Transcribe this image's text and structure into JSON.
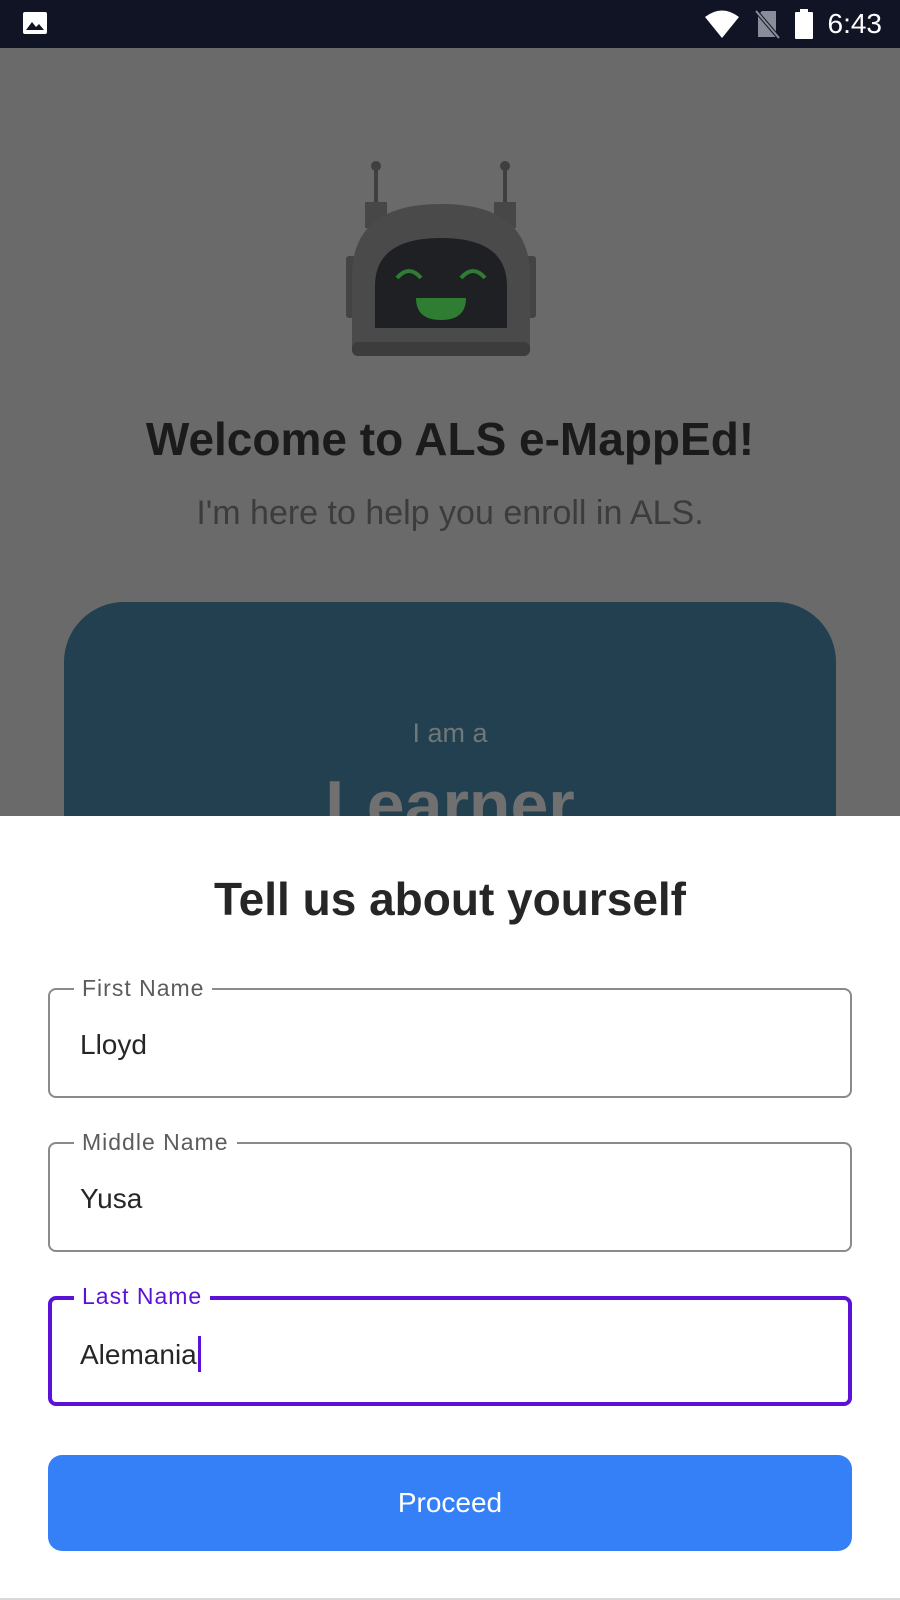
{
  "status_bar": {
    "time": "6:43",
    "icons": [
      "gallery-icon",
      "wifi-icon",
      "no-sim-icon",
      "battery-icon"
    ]
  },
  "background": {
    "welcome_title": "Welcome to ALS e-MappEd!",
    "welcome_subtitle": "I'm here to help you enroll in ALS.",
    "role_card": {
      "prefix": "I am a",
      "role": "Learner"
    }
  },
  "sheet": {
    "title": "Tell us about yourself",
    "fields": {
      "first_name": {
        "label": "First Name",
        "value": "Lloyd"
      },
      "middle_name": {
        "label": "Middle Name",
        "value": "Yusa"
      },
      "last_name": {
        "label": "Last Name",
        "value": "Alemania"
      }
    },
    "proceed_label": "Proceed"
  },
  "colors": {
    "accent_focus": "#5b12d6",
    "button": "#3580f6",
    "scrim_background": "#6a6a6a",
    "role_card": "#22404f"
  }
}
